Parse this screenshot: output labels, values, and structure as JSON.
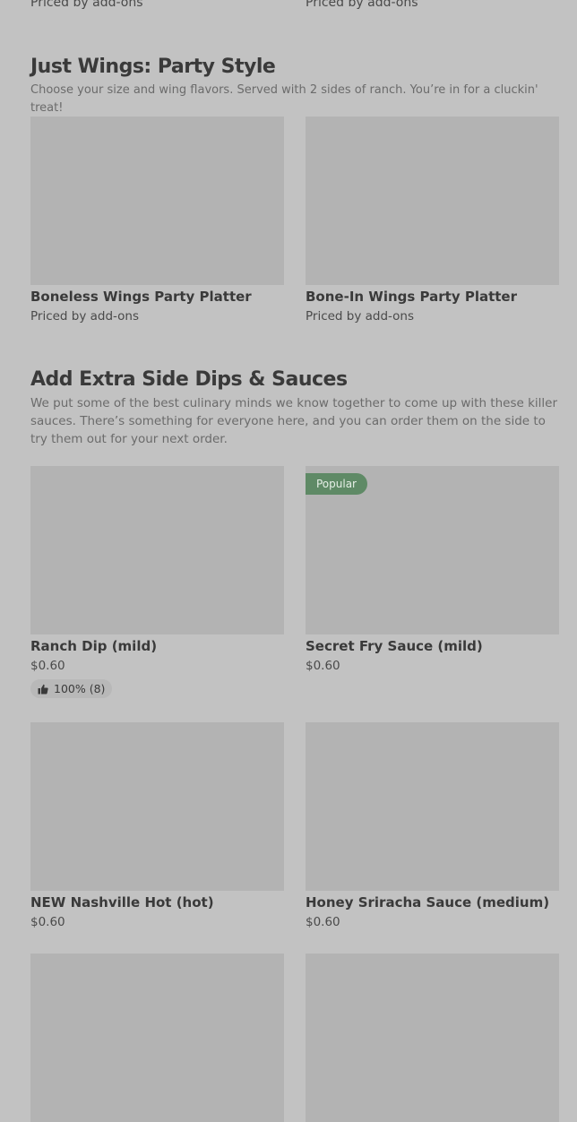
{
  "top_prices": [
    "Priced by add-ons",
    "Priced by add-ons"
  ],
  "section_wings": {
    "title": "Just Wings: Party Style",
    "description": "Choose your size and wing flavors. Served with 2 sides of ranch. You’re in for a cluckin' treat!",
    "items": [
      {
        "name": "Boneless Wings Party Platter",
        "price": "Priced by add-ons"
      },
      {
        "name": "Bone-In Wings Party Platter",
        "price": "Priced by add-ons"
      }
    ]
  },
  "section_dips": {
    "title": "Add Extra Side Dips & Sauces",
    "description": "We put some of the best culinary minds we know together to come up with these killer sauces. There’s something for everyone here, and you can order them on the side to try them out for your next order.",
    "items": [
      {
        "name": "Ranch Dip (mild)",
        "price": "$0.60",
        "rating": "100% (8)"
      },
      {
        "name": "Secret Fry Sauce (mild)",
        "price": "$0.60",
        "badge": "Popular"
      },
      {
        "name": "NEW Nashville Hot (hot)",
        "price": "$0.60"
      },
      {
        "name": "Honey Sriracha Sauce (medium)",
        "price": "$0.60"
      }
    ]
  }
}
